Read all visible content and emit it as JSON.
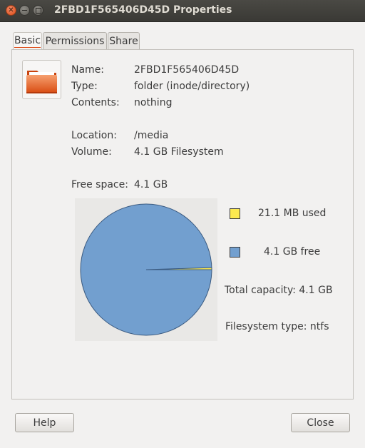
{
  "window": {
    "title": "2FBD1F565406D45D Properties"
  },
  "tabs": [
    {
      "label": "Basic"
    },
    {
      "label": "Permissions"
    },
    {
      "label": "Share"
    }
  ],
  "basic": {
    "name_label": "Name:",
    "name_value": "2FBD1F565406D45D",
    "type_label": "Type:",
    "type_value": "folder (inode/directory)",
    "contents_label": "Contents:",
    "contents_value": "nothing",
    "location_label": "Location:",
    "location_value": "/media",
    "volume_label": "Volume:",
    "volume_value": "4.1 GB Filesystem",
    "free_label": "Free space:",
    "free_value": "4.1 GB"
  },
  "usage": {
    "used_label": "21.1 MB used",
    "free_label": "4.1 GB free",
    "capacity_text": "Total capacity: 4.1 GB",
    "fstype_text": "Filesystem type: ntfs",
    "used_fraction": 0.005,
    "used_color": "#fce94f",
    "free_color": "#729fcf"
  },
  "buttons": {
    "help": "Help",
    "close": "Close"
  }
}
